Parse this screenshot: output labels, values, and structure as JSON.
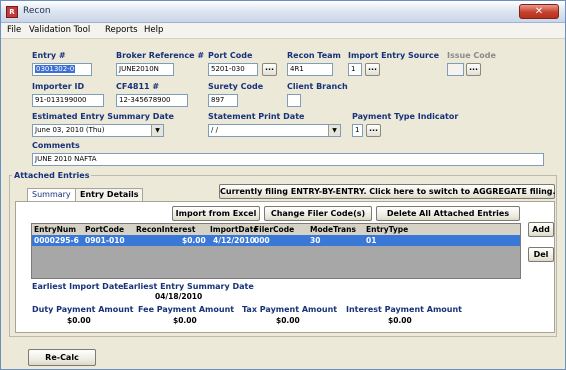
{
  "window": {
    "title": "Recon",
    "icon_text": "R",
    "close_glyph": "✕"
  },
  "menu": [
    "File",
    "Validation Tool",
    "Reports",
    "Help"
  ],
  "header": {
    "entry_no_label": "Entry #",
    "entry_no": "0301302-0",
    "broker_ref_label": "Broker Reference #",
    "broker_ref": "JUNE2010N",
    "port_code_label": "Port Code",
    "port_code": "5201-030",
    "recon_team_label": "Recon Team",
    "recon_team": "4R1",
    "import_source_label": "Import Entry Source",
    "import_source": "1",
    "issue_code_label": "Issue Code",
    "issue_code": "",
    "importer_id_label": "Importer ID",
    "importer_id": "91-013199000",
    "cf4811_label": "CF4811 #",
    "cf4811": "12-345678900",
    "surety_code_label": "Surety Code",
    "surety_code": "897",
    "client_branch_label": "Client Branch",
    "client_branch": "",
    "est_summary_date_label": "Estimated Entry Summary Date",
    "est_summary_date": "June 03, 2010 (Thu)",
    "statement_print_date_label": "Statement Print Date",
    "statement_print_date": "/ /",
    "payment_type_label": "Payment Type Indicator",
    "payment_type": "1",
    "comments_label": "Comments",
    "comments": "JUNE 2010 NAFTA",
    "ellipsis": "..."
  },
  "attached": {
    "group_label": "Attached Entries",
    "tabs": [
      "Summary",
      "Entry Details"
    ],
    "filing_button": "Currently filing ENTRY-BY-ENTRY.  Click here to switch to AGGREGATE filing.",
    "import_excel": "Import from Excel",
    "change_filer": "Change Filer Code(s)",
    "delete_all": "Delete All Attached Entries",
    "add": "Add",
    "del": "Del",
    "columns": [
      "EntryNum",
      "PortCode",
      "ReconInterest",
      "ImportDate",
      "FilerCode",
      "ModeTrans",
      "EntryType"
    ],
    "rows": [
      [
        "0000295-6",
        "0901-010",
        "$0.00",
        "4/12/2010",
        "000",
        "30",
        "01"
      ]
    ],
    "earliest_import_label": "Earliest Import Date",
    "earliest_import": "",
    "earliest_summary_label": "Earliest Entry Summary Date",
    "earliest_summary": "04/18/2010",
    "duty_label": "Duty Payment Amount",
    "duty": "$0.00",
    "fee_label": "Fee Payment Amount",
    "fee": "$0.00",
    "tax_label": "Tax Payment Amount",
    "tax": "$0.00",
    "interest_label": "Interest Payment Amount",
    "interest": "$0.00"
  },
  "footer": {
    "recalc": "Re-Calc"
  },
  "colors": {
    "label_blue": "#17327a",
    "selection": "#3a78d8",
    "window_bg": "#ece9d8"
  }
}
